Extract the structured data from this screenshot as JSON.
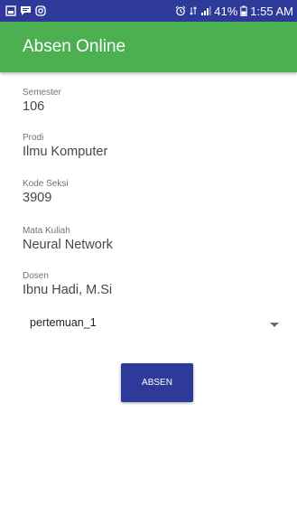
{
  "status_bar": {
    "battery_percent": "41%",
    "time": "1:55 AM",
    "icons": [
      "gallery-icon",
      "message-icon",
      "instagram-icon",
      "alarm-icon",
      "data-icon",
      "signal-icon",
      "battery-icon"
    ]
  },
  "app_bar": {
    "title": "Absen Online",
    "color": "#4caf50"
  },
  "form": {
    "fields": [
      {
        "label": "Semester",
        "value": "106"
      },
      {
        "label": "Prodi",
        "value": "Ilmu Komputer"
      },
      {
        "label": "Kode Seksi",
        "value": "3909"
      },
      {
        "label": "Mata Kuliah",
        "value": "Neural Network"
      },
      {
        "label": "Dosen",
        "value": "Ibnu Hadi, M.Si"
      }
    ],
    "spinner_value": "pertemuan_1",
    "submit_label": "ABSEN",
    "accent_color": "#2e3a9a"
  }
}
